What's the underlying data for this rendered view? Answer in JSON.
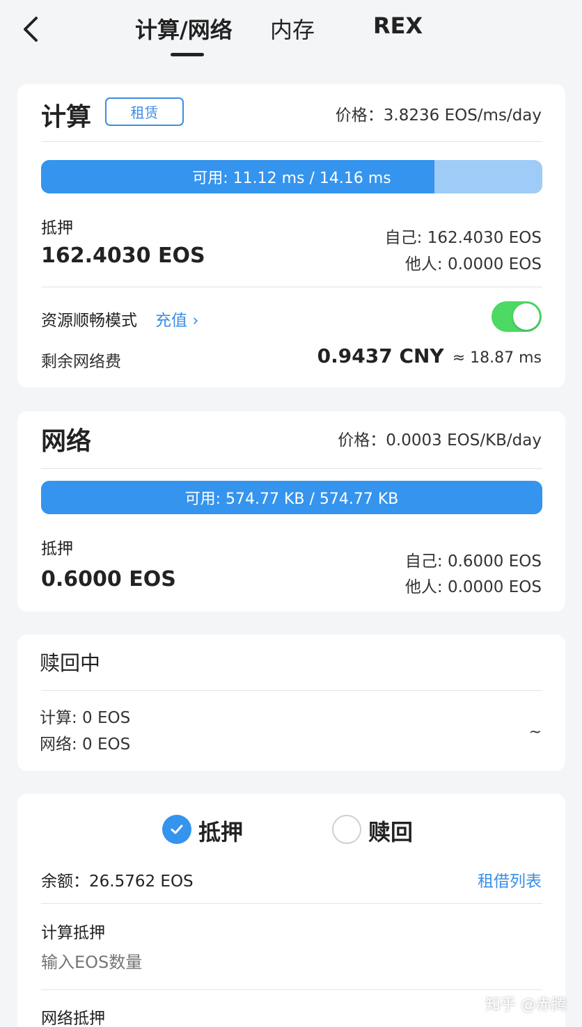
{
  "header": {
    "back_icon": "chevron-left-icon",
    "tabs": [
      {
        "label": "计算/网络",
        "active": true
      },
      {
        "label": "内存",
        "active": false
      },
      {
        "label": "REX",
        "active": false
      }
    ]
  },
  "compute": {
    "title": "计算",
    "rent_label": "租赁",
    "price": "价格：3.8236 EOS/ms/day",
    "usage_text": "可用: 11.12 ms / 14.16 ms",
    "usage_fraction": 0.785,
    "stake_label": "抵押",
    "stake_value": "162.4030 EOS",
    "self_stake": "自己: 162.4030 EOS",
    "others_stake": "他人: 0.0000 EOS",
    "smooth_mode_label": "资源顺畅模式",
    "recharge_label": "充值 ›",
    "smooth_mode_enabled": true,
    "remaining_fee_label": "剩余网络费",
    "remaining_fee_value": "0.9437 CNY",
    "remaining_fee_approx": "≈ 18.87 ms"
  },
  "network": {
    "title": "网络",
    "price": "价格：0.0003 EOS/KB/day",
    "usage_text": "可用: 574.77 KB / 574.77 KB",
    "usage_fraction": 1.0,
    "stake_label": "抵押",
    "stake_value": "0.6000 EOS",
    "self_stake": "自己: 0.6000 EOS",
    "others_stake": "他人: 0.0000 EOS"
  },
  "redeeming": {
    "title": "赎回中",
    "compute_line": "计算: 0 EOS",
    "network_line": "网络: 0 EOS",
    "time_text": "~"
  },
  "form": {
    "option_stake": "抵押",
    "option_redeem": "赎回",
    "selected": "stake",
    "balance": "余额：26.5762 EOS",
    "lease_list_link": "租借列表",
    "compute_stake_label": "计算抵押",
    "compute_stake_placeholder": "输入EOS数量",
    "network_stake_label": "网络抵押"
  },
  "watermark": "知乎 @赤腾",
  "colors": {
    "accent_blue": "#3494ee",
    "bar_remaining": "#9ecbf7",
    "toggle_on": "#4cd964",
    "link_blue": "#3a8ee6"
  }
}
